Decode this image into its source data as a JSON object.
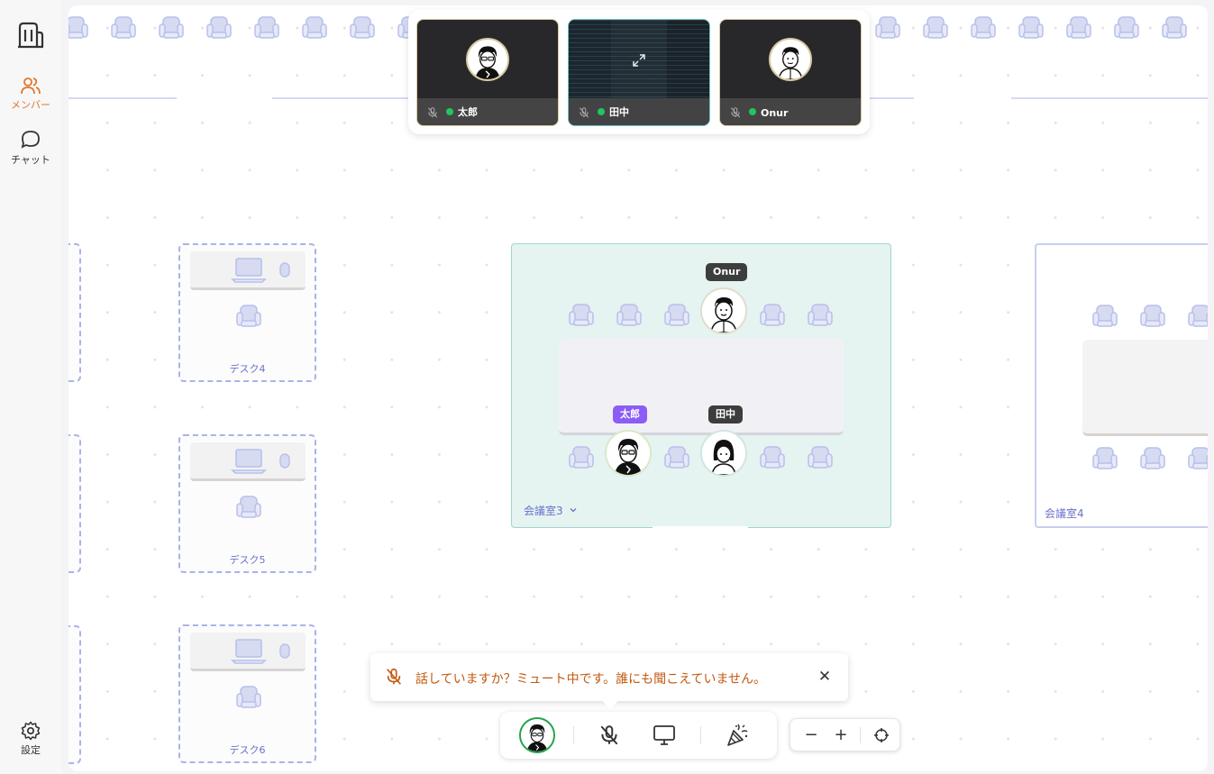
{
  "sidebar": {
    "members_label": "メンバー",
    "chat_label": "チャット",
    "settings_label": "設定"
  },
  "video": {
    "tiles": [
      {
        "name": "太郎",
        "muted": true,
        "online": true
      },
      {
        "name": "田中",
        "muted": true,
        "online": true,
        "screen_share": true
      },
      {
        "name": "Onur",
        "muted": true,
        "online": true
      }
    ]
  },
  "desks": {
    "d4": "デスク4",
    "d5": "デスク5",
    "d6": "デスク6"
  },
  "rooms": {
    "room3_label": "会議室3",
    "room4_label": "会議室4"
  },
  "room3_members": {
    "onur": "Onur",
    "taro": "太郎",
    "tanaka": "田中"
  },
  "notice": {
    "message": "話していますか？ミュート中です。誰にも聞こえていません。",
    "close": "✕"
  },
  "zoom": {
    "minus": "−",
    "plus": "+"
  },
  "colors": {
    "accent": "#e0762b",
    "online": "#22c55e",
    "room_bg": "#e5f3f1",
    "room_border": "#9dd8cb",
    "desk_border": "#a9b3ea",
    "taro_tag": "#8b5cf6",
    "warning_text": "#c2590f"
  }
}
